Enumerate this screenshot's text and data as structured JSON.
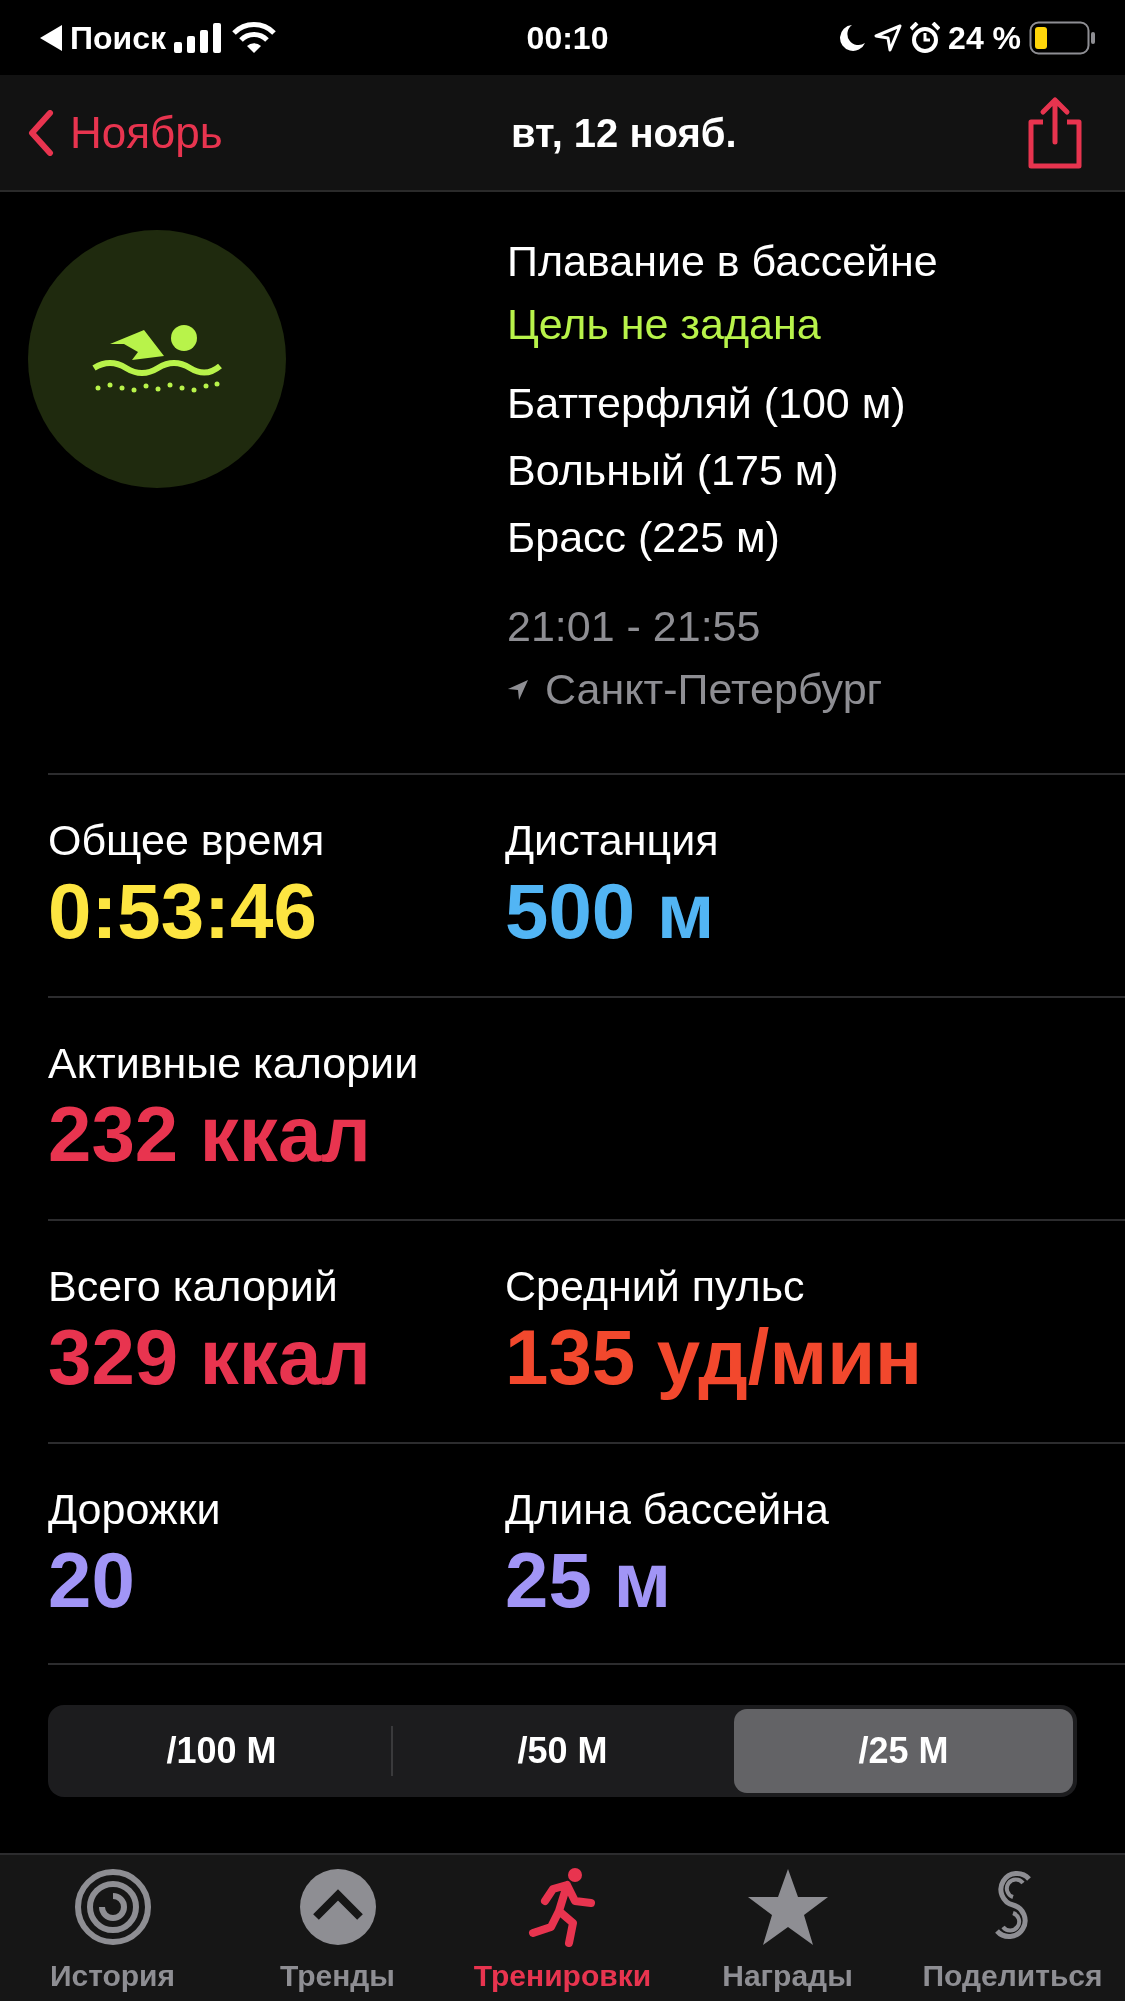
{
  "status_bar": {
    "back_label": "Поиск",
    "time": "00:10",
    "battery": "24 %"
  },
  "nav": {
    "back": "Ноябрь",
    "title": "вт, 12 нояб."
  },
  "workout": {
    "name": "Плавание в бассейне",
    "goal": "Цель не задана",
    "strokes": [
      "Баттерфляй (100 м)",
      "Вольный (175 м)",
      "Брасс (225 м)"
    ],
    "time_range": "21:01 - 21:55",
    "location": "Санкт-Петербург"
  },
  "metrics": [
    [
      {
        "label": "Общее время",
        "value": "0:53:46",
        "color": "#fde541"
      },
      {
        "label": "Дистанция",
        "value": "500 м",
        "color": "#52b5f4"
      }
    ],
    [
      {
        "label": "Активные калории",
        "value": "232 ккал",
        "color": "#e8344f"
      }
    ],
    [
      {
        "label": "Всего калорий",
        "value": "329 ккал",
        "color": "#e8344f"
      },
      {
        "label": "Средний пульс",
        "value": "135 уд/мин",
        "color": "#f2482d"
      }
    ],
    [
      {
        "label": "Дорожки",
        "value": "20",
        "color": "#a195f6"
      },
      {
        "label": "Длина бассейна",
        "value": "25 м",
        "color": "#a195f6"
      }
    ]
  ],
  "segments": [
    {
      "label": "/100 М",
      "selected": false
    },
    {
      "label": "/50 М",
      "selected": false
    },
    {
      "label": "/25 М",
      "selected": true
    }
  ],
  "tabs": [
    {
      "label": "История",
      "kind": "rings",
      "selected": false
    },
    {
      "label": "Тренды",
      "kind": "trends",
      "selected": false
    },
    {
      "label": "Тренировки",
      "kind": "runner",
      "selected": true
    },
    {
      "label": "Награды",
      "kind": "star",
      "selected": false
    },
    {
      "label": "Поделиться",
      "kind": "share",
      "selected": false
    }
  ]
}
